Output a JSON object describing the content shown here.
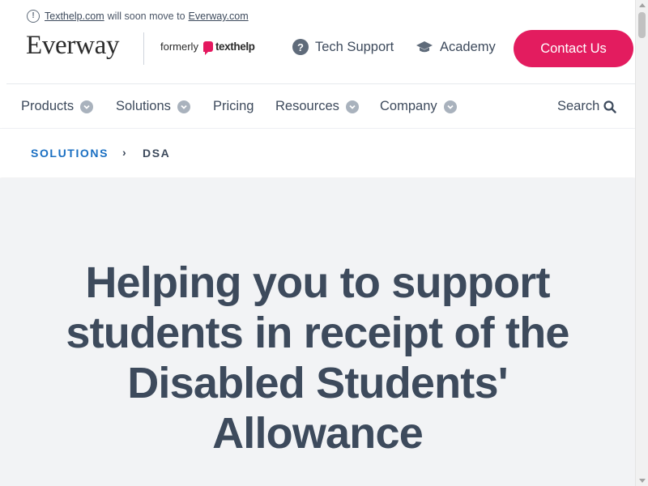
{
  "notice": {
    "icon": "info-icon",
    "old_link": "Texthelp.com",
    "middle": "will soon move to",
    "new_link": "Everway.com"
  },
  "header": {
    "logo_text": "Everway",
    "formerly_label": "formerly",
    "texthelp_word": "texthelp",
    "tech_support": "Tech Support",
    "academy": "Academy",
    "contact_button": "Contact Us",
    "accent_color": "#e31c5f"
  },
  "nav": {
    "items": [
      {
        "label": "Products",
        "has_dropdown": true
      },
      {
        "label": "Solutions",
        "has_dropdown": true
      },
      {
        "label": "Pricing",
        "has_dropdown": false
      },
      {
        "label": "Resources",
        "has_dropdown": true
      },
      {
        "label": "Company",
        "has_dropdown": true
      }
    ],
    "search_label": "Search"
  },
  "breadcrumb": {
    "items": [
      "SOLUTIONS",
      "DSA"
    ],
    "separator": "›",
    "link_color": "#1a6fc2"
  },
  "hero": {
    "title": "Helping you to support students in receipt of the Disabled Students' Allowance",
    "background": "#f2f3f5"
  }
}
